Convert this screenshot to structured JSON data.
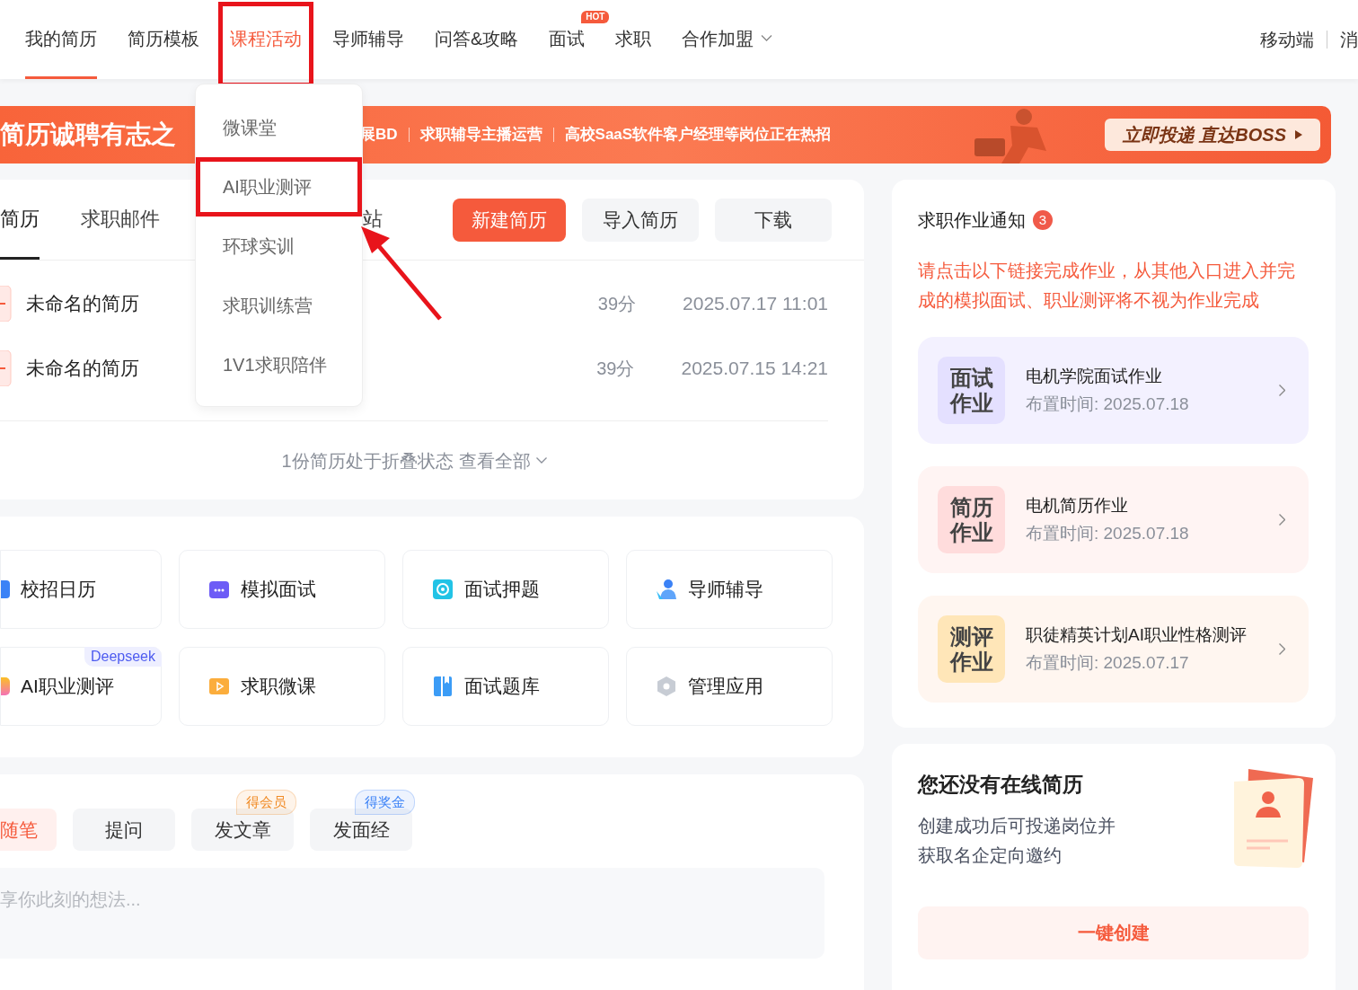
{
  "nav": {
    "items": [
      {
        "label": "我的简历",
        "selected": true,
        "expanded": false,
        "highlighted": false
      },
      {
        "label": "简历模板",
        "selected": false,
        "expanded": false,
        "highlighted": false
      },
      {
        "label": "课程活动",
        "selected": false,
        "expanded": true,
        "highlighted": true
      },
      {
        "label": "导师辅导",
        "selected": false,
        "expanded": false,
        "highlighted": false
      },
      {
        "label": "问答&攻略",
        "selected": false,
        "expanded": false,
        "highlighted": false
      },
      {
        "label": "面试",
        "selected": false,
        "expanded": false,
        "highlighted": false,
        "badge": "HOT"
      },
      {
        "label": "求职",
        "selected": false,
        "expanded": false,
        "highlighted": false
      },
      {
        "label": "合作加盟",
        "selected": false,
        "expanded": false,
        "highlighted": false
      }
    ],
    "right": [
      "移动端",
      "消"
    ]
  },
  "dropdown": {
    "items": [
      {
        "label": "微课堂",
        "highlighted": false
      },
      {
        "label": "AI职业测评",
        "highlighted": true
      },
      {
        "label": "环球实训",
        "highlighted": false
      },
      {
        "label": "求职训练营",
        "highlighted": false
      },
      {
        "label": "1V1求职陪伴",
        "highlighted": false
      }
    ]
  },
  "banner": {
    "title": "简历诚聘有志之",
    "jobs": [
      "展BD",
      "求职辅导主播运营",
      "高校SaaS软件客户经理等岗位正在热招"
    ],
    "button": "立即投递 直达BOSS"
  },
  "resumes": {
    "tabs": [
      {
        "label": "简历",
        "selected": true
      },
      {
        "label": "求职邮件",
        "selected": false
      },
      {
        "label": "站",
        "selected": false
      }
    ],
    "buttons": [
      {
        "label": "新建简历",
        "kind": "primary"
      },
      {
        "label": "导入简历",
        "kind": "secondary"
      },
      {
        "label": "下载",
        "kind": "secondary"
      }
    ],
    "rows": [
      {
        "name": "未命名的简历",
        "score": "39分",
        "date": "2025.07.17 11:01"
      },
      {
        "name": "未命名的简历",
        "score": "39分",
        "date": "2025.07.15 14:21"
      }
    ],
    "footer": {
      "text": "1份简历处于折叠状态",
      "link": "查看全部"
    }
  },
  "tools": [
    {
      "label": "校招日历",
      "kind": "calendar"
    },
    {
      "label": "模拟面试",
      "kind": "robot"
    },
    {
      "label": "面试押题",
      "kind": "target"
    },
    {
      "label": "导师辅导",
      "kind": "mentor"
    },
    {
      "label": "AI职业测评",
      "kind": "ai",
      "badge": "Deepseek"
    },
    {
      "label": "求职微课",
      "kind": "video"
    },
    {
      "label": "面试题库",
      "kind": "book"
    },
    {
      "label": "管理应用",
      "kind": "hexagon"
    }
  ],
  "post": {
    "tabs": [
      {
        "label": "随笔",
        "selected": true
      },
      {
        "label": "提问",
        "selected": false
      },
      {
        "label": "发文章",
        "selected": false,
        "badge": "得会员",
        "color": "#f08a24"
      },
      {
        "label": "发面经",
        "selected": false,
        "badge": "得奖金",
        "color": "#3b82f6"
      }
    ],
    "placeholder": "享你此刻的想法..."
  },
  "homework": {
    "title": "求职作业通知",
    "count": "3",
    "notice": "请点击以下链接完成作业，从其他入口进入并完成的模拟面试、职业测评将不视为作业完成",
    "items": [
      {
        "kind": "interview",
        "tag": "面试作业",
        "title": "电机学院面试作业",
        "time": "布置时间: 2025.07.18"
      },
      {
        "kind": "resume",
        "tag": "简历作业",
        "title": "电机简历作业",
        "time": "布置时间: 2025.07.18"
      },
      {
        "kind": "test",
        "tag": "测评作业",
        "title": "职徒精英计划AI职业性格测评",
        "time": "布置时间: 2025.07.17"
      }
    ]
  },
  "empty": {
    "title": "您还没有在线简历",
    "text": "创建成功后可投递岗位并获取名企定向邀约",
    "button": "一键创建"
  }
}
